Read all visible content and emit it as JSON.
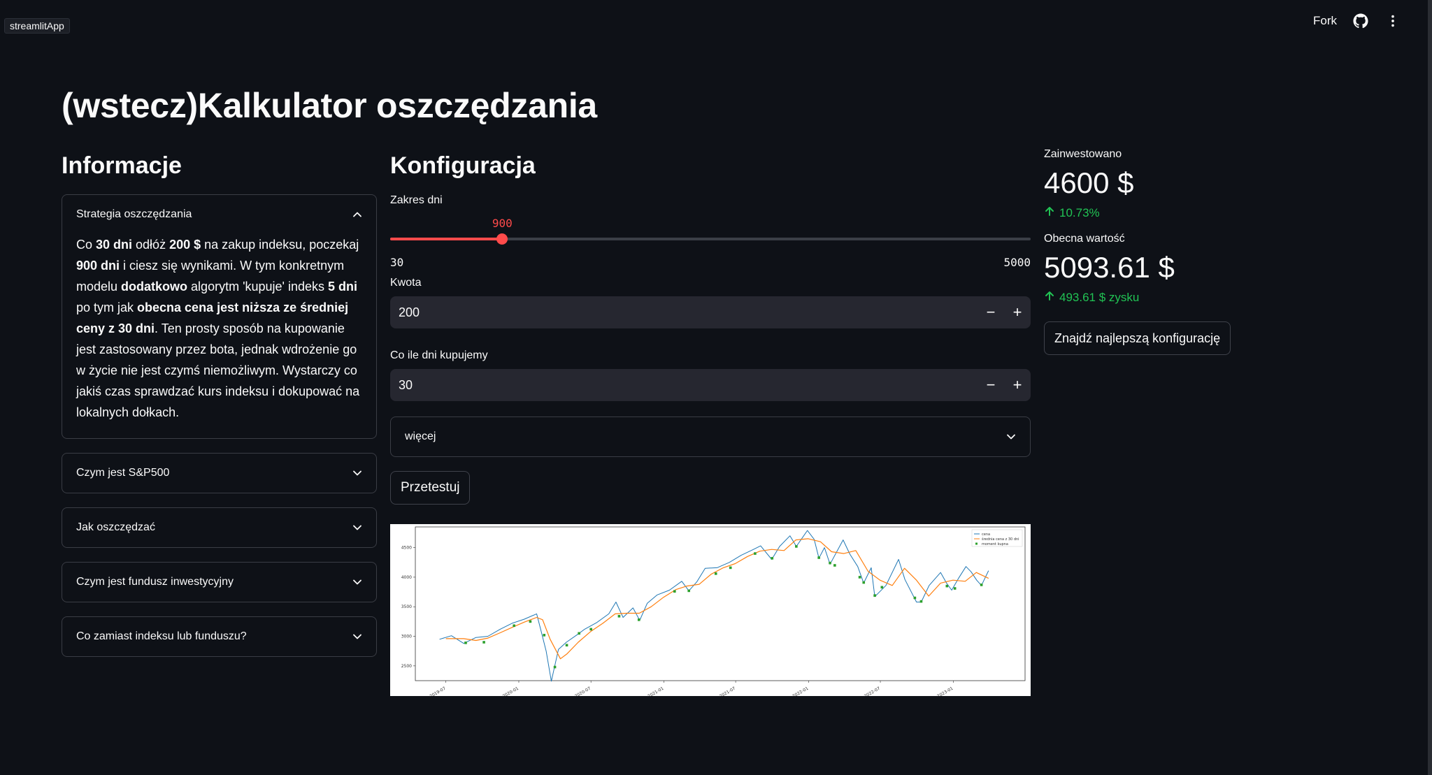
{
  "app": {
    "badge": "streamlitApp",
    "fork_label": "Fork"
  },
  "icons": {
    "github": "github-icon",
    "menu": "more-vertical-icon"
  },
  "colors": {
    "background": "#0e1117",
    "accent": "#ff4b4b",
    "positive": "#21c354",
    "input_bg": "#262730"
  },
  "title": "(wstecz)Kalkulator oszczędzania",
  "informacje": {
    "heading": "Informacje",
    "expanders": [
      {
        "label": "Strategia oszczędzania",
        "open": true
      },
      {
        "label": "Czym jest S&P500",
        "open": false
      },
      {
        "label": "Jak oszczędzać",
        "open": false
      },
      {
        "label": "Czym jest fundusz inwestycyjny",
        "open": false
      },
      {
        "label": "Co zamiast indeksu lub funduszu?",
        "open": false
      }
    ],
    "strategy_text": {
      "p1": "Co ",
      "b1": "30 dni",
      "p2": " odłóż ",
      "b2": "200 $",
      "p3": " na zakup indeksu, poczekaj ",
      "b3": "900 dni",
      "p4": " i ciesz się wynikami. W tym konkretnym modelu ",
      "b4": "dodatkowo",
      "p5": " algorytm 'kupuje' indeks ",
      "b5": "5 dni",
      "p6": " po tym jak ",
      "b6": "obecna cena jest niższa ze średniej ceny z 30 dni",
      "p7": ". Ten prosty sposób na kupowanie jest zastosowany przez bota, jednak wdrożenie go w życie nie jest czymś niemożliwym. Wystarczy co jakiś czas sprawdzać kurs indeksu i dokupować na lokalnych dołkach."
    }
  },
  "konfiguracja": {
    "heading": "Konfiguracja",
    "slider": {
      "label": "Zakres dni",
      "value": 900,
      "value_text": "900",
      "min": 30,
      "max": 5000,
      "min_text": "30",
      "max_text": "5000"
    },
    "kwota": {
      "label": "Kwota",
      "value": "200"
    },
    "interval": {
      "label": "Co ile dni kupujemy",
      "value": "30"
    },
    "more": {
      "label": "więcej"
    },
    "test_button": "Przetestuj"
  },
  "metrics": {
    "invested": {
      "label": "Zainwestowano",
      "value": "4600 $",
      "delta": "10.73%"
    },
    "current": {
      "label": "Obecna wartość",
      "value": "5093.61 $",
      "delta": "493.61 $ zysku"
    },
    "best_button": "Znajdź najlepszą konfigurację"
  },
  "chart_data": {
    "type": "line",
    "title": "",
    "xlabel": "",
    "ylabel": "",
    "x_ticks": [
      "2019-07",
      "2020-01",
      "2020-07",
      "2021-01",
      "2021-07",
      "2022-01",
      "2022-07",
      "2023-01"
    ],
    "y_ticks": [
      2500,
      3000,
      3500,
      4000,
      4500
    ],
    "ylim": [
      2250,
      4850
    ],
    "legend": [
      "cena",
      "średnia cena z 30 dni",
      "moment kupna"
    ],
    "legend_position": "top-right",
    "series": [
      {
        "name": "cena",
        "color": "#1f77b4",
        "values": [
          [
            "2019-06-15",
            2950
          ],
          [
            "2019-07-15",
            3010
          ],
          [
            "2019-08-15",
            2880
          ],
          [
            "2019-09-15",
            2980
          ],
          [
            "2019-10-15",
            3000
          ],
          [
            "2019-11-15",
            3120
          ],
          [
            "2019-12-15",
            3220
          ],
          [
            "2020-01-15",
            3290
          ],
          [
            "2020-02-15",
            3380
          ],
          [
            "2020-02-25",
            3120
          ],
          [
            "2020-03-10",
            2750
          ],
          [
            "2020-03-23",
            2240
          ],
          [
            "2020-04-10",
            2780
          ],
          [
            "2020-04-30",
            2900
          ],
          [
            "2020-05-30",
            3040
          ],
          [
            "2020-06-15",
            3120
          ],
          [
            "2020-07-15",
            3230
          ],
          [
            "2020-08-15",
            3380
          ],
          [
            "2020-09-02",
            3580
          ],
          [
            "2020-09-20",
            3320
          ],
          [
            "2020-10-15",
            3480
          ],
          [
            "2020-11-01",
            3270
          ],
          [
            "2020-11-20",
            3560
          ],
          [
            "2020-12-15",
            3700
          ],
          [
            "2021-01-15",
            3780
          ],
          [
            "2021-02-15",
            3930
          ],
          [
            "2021-03-05",
            3770
          ],
          [
            "2021-03-25",
            3920
          ],
          [
            "2021-04-15",
            4150
          ],
          [
            "2021-05-15",
            4160
          ],
          [
            "2021-06-15",
            4250
          ],
          [
            "2021-07-15",
            4370
          ],
          [
            "2021-08-15",
            4470
          ],
          [
            "2021-09-02",
            4530
          ],
          [
            "2021-09-30",
            4300
          ],
          [
            "2021-10-20",
            4520
          ],
          [
            "2021-11-15",
            4700
          ],
          [
            "2021-12-01",
            4520
          ],
          [
            "2021-12-29",
            4790
          ],
          [
            "2022-01-15",
            4640
          ],
          [
            "2022-01-27",
            4320
          ],
          [
            "2022-02-10",
            4500
          ],
          [
            "2022-02-24",
            4220
          ],
          [
            "2022-03-29",
            4630
          ],
          [
            "2022-04-15",
            4390
          ],
          [
            "2022-05-05",
            4180
          ],
          [
            "2022-05-20",
            3900
          ],
          [
            "2022-06-08",
            4160
          ],
          [
            "2022-06-17",
            3670
          ],
          [
            "2022-07-15",
            3860
          ],
          [
            "2022-08-16",
            4300
          ],
          [
            "2022-09-01",
            3960
          ],
          [
            "2022-09-30",
            3580
          ],
          [
            "2022-10-12",
            3580
          ],
          [
            "2022-11-01",
            3860
          ],
          [
            "2022-11-30",
            4080
          ],
          [
            "2022-12-15",
            3900
          ],
          [
            "2022-12-28",
            3780
          ],
          [
            "2023-01-15",
            3990
          ],
          [
            "2023-02-02",
            4180
          ],
          [
            "2023-02-15",
            4090
          ],
          [
            "2023-03-01",
            3950
          ],
          [
            "2023-03-13",
            3860
          ],
          [
            "2023-03-31",
            4110
          ]
        ]
      },
      {
        "name": "średnia cena z 30 dni",
        "color": "#ff7f0e",
        "values": [
          [
            "2019-07-01",
            2960
          ],
          [
            "2019-08-15",
            2960
          ],
          [
            "2019-09-15",
            2930
          ],
          [
            "2019-10-15",
            2970
          ],
          [
            "2019-11-15",
            3060
          ],
          [
            "2019-12-15",
            3150
          ],
          [
            "2020-01-15",
            3240
          ],
          [
            "2020-02-15",
            3320
          ],
          [
            "2020-03-01",
            3280
          ],
          [
            "2020-03-20",
            2950
          ],
          [
            "2020-04-15",
            2620
          ],
          [
            "2020-05-01",
            2700
          ],
          [
            "2020-05-30",
            2900
          ],
          [
            "2020-06-30",
            3080
          ],
          [
            "2020-07-31",
            3220
          ],
          [
            "2020-08-31",
            3380
          ],
          [
            "2020-09-30",
            3390
          ],
          [
            "2020-10-31",
            3390
          ],
          [
            "2020-11-30",
            3500
          ],
          [
            "2020-12-31",
            3660
          ],
          [
            "2021-01-31",
            3790
          ],
          [
            "2021-02-28",
            3850
          ],
          [
            "2021-03-31",
            3880
          ],
          [
            "2021-04-30",
            4050
          ],
          [
            "2021-05-31",
            4160
          ],
          [
            "2021-06-30",
            4230
          ],
          [
            "2021-07-31",
            4350
          ],
          [
            "2021-08-31",
            4440
          ],
          [
            "2021-09-30",
            4470
          ],
          [
            "2021-10-31",
            4450
          ],
          [
            "2021-11-30",
            4630
          ],
          [
            "2021-12-31",
            4650
          ],
          [
            "2022-01-31",
            4600
          ],
          [
            "2022-02-28",
            4430
          ],
          [
            "2022-03-31",
            4400
          ],
          [
            "2022-04-30",
            4450
          ],
          [
            "2022-05-31",
            4100
          ],
          [
            "2022-06-30",
            3950
          ],
          [
            "2022-07-31",
            3860
          ],
          [
            "2022-08-31",
            4150
          ],
          [
            "2022-09-30",
            3950
          ],
          [
            "2022-10-31",
            3680
          ],
          [
            "2022-11-30",
            3900
          ],
          [
            "2022-12-31",
            3950
          ],
          [
            "2023-01-31",
            3930
          ],
          [
            "2023-02-28",
            4080
          ],
          [
            "2023-03-31",
            3980
          ]
        ]
      }
    ],
    "buy_points": [
      [
        "2019-08-20",
        2890
      ],
      [
        "2019-10-05",
        2900
      ],
      [
        "2019-12-20",
        3180
      ],
      [
        "2020-01-30",
        3250
      ],
      [
        "2020-03-05",
        3020
      ],
      [
        "2020-04-01",
        2480
      ],
      [
        "2020-05-01",
        2850
      ],
      [
        "2020-06-01",
        3050
      ],
      [
        "2020-07-01",
        3120
      ],
      [
        "2020-09-10",
        3340
      ],
      [
        "2020-10-30",
        3280
      ],
      [
        "2021-01-28",
        3760
      ],
      [
        "2021-03-05",
        3770
      ],
      [
        "2021-05-12",
        4060
      ],
      [
        "2021-06-18",
        4160
      ],
      [
        "2021-08-19",
        4400
      ],
      [
        "2021-10-01",
        4320
      ],
      [
        "2021-12-01",
        4520
      ],
      [
        "2022-01-27",
        4330
      ],
      [
        "2022-02-24",
        4240
      ],
      [
        "2022-03-08",
        4200
      ],
      [
        "2022-05-10",
        4000
      ],
      [
        "2022-05-20",
        3910
      ],
      [
        "2022-06-17",
        3690
      ],
      [
        "2022-07-05",
        3830
      ],
      [
        "2022-09-26",
        3650
      ],
      [
        "2022-10-12",
        3590
      ],
      [
        "2022-12-16",
        3850
      ],
      [
        "2023-01-05",
        3810
      ],
      [
        "2023-03-13",
        3870
      ]
    ]
  }
}
